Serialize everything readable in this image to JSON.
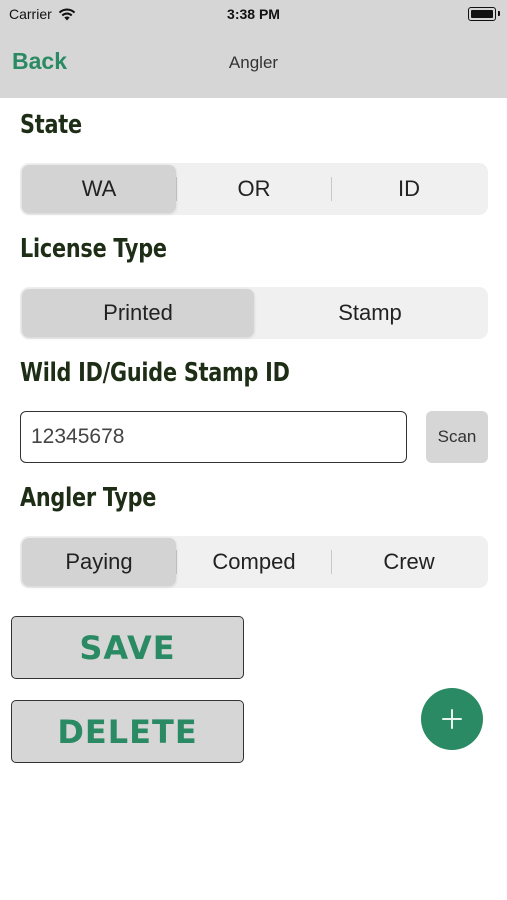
{
  "status_bar": {
    "carrier": "Carrier",
    "time": "3:38 PM"
  },
  "nav": {
    "back_label": "Back",
    "title": "Angler"
  },
  "state": {
    "heading": "State",
    "options": [
      "WA",
      "OR",
      "ID"
    ],
    "selected": "WA"
  },
  "license_type": {
    "heading": "License Type",
    "options": [
      "Printed",
      "Stamp"
    ],
    "selected": "Printed"
  },
  "wild_id": {
    "heading": "Wild ID/Guide Stamp ID",
    "value": "12345678",
    "scan_label": "Scan"
  },
  "angler_type": {
    "heading": "Angler Type",
    "options": [
      "Paying",
      "Comped",
      "Crew"
    ],
    "selected": "Paying"
  },
  "actions": {
    "save_label": "SAVE",
    "delete_label": "DELETE"
  },
  "colors": {
    "accent": "#2a8a63",
    "header_bg": "#d6d6d6",
    "heading_text": "#1e2d16"
  }
}
